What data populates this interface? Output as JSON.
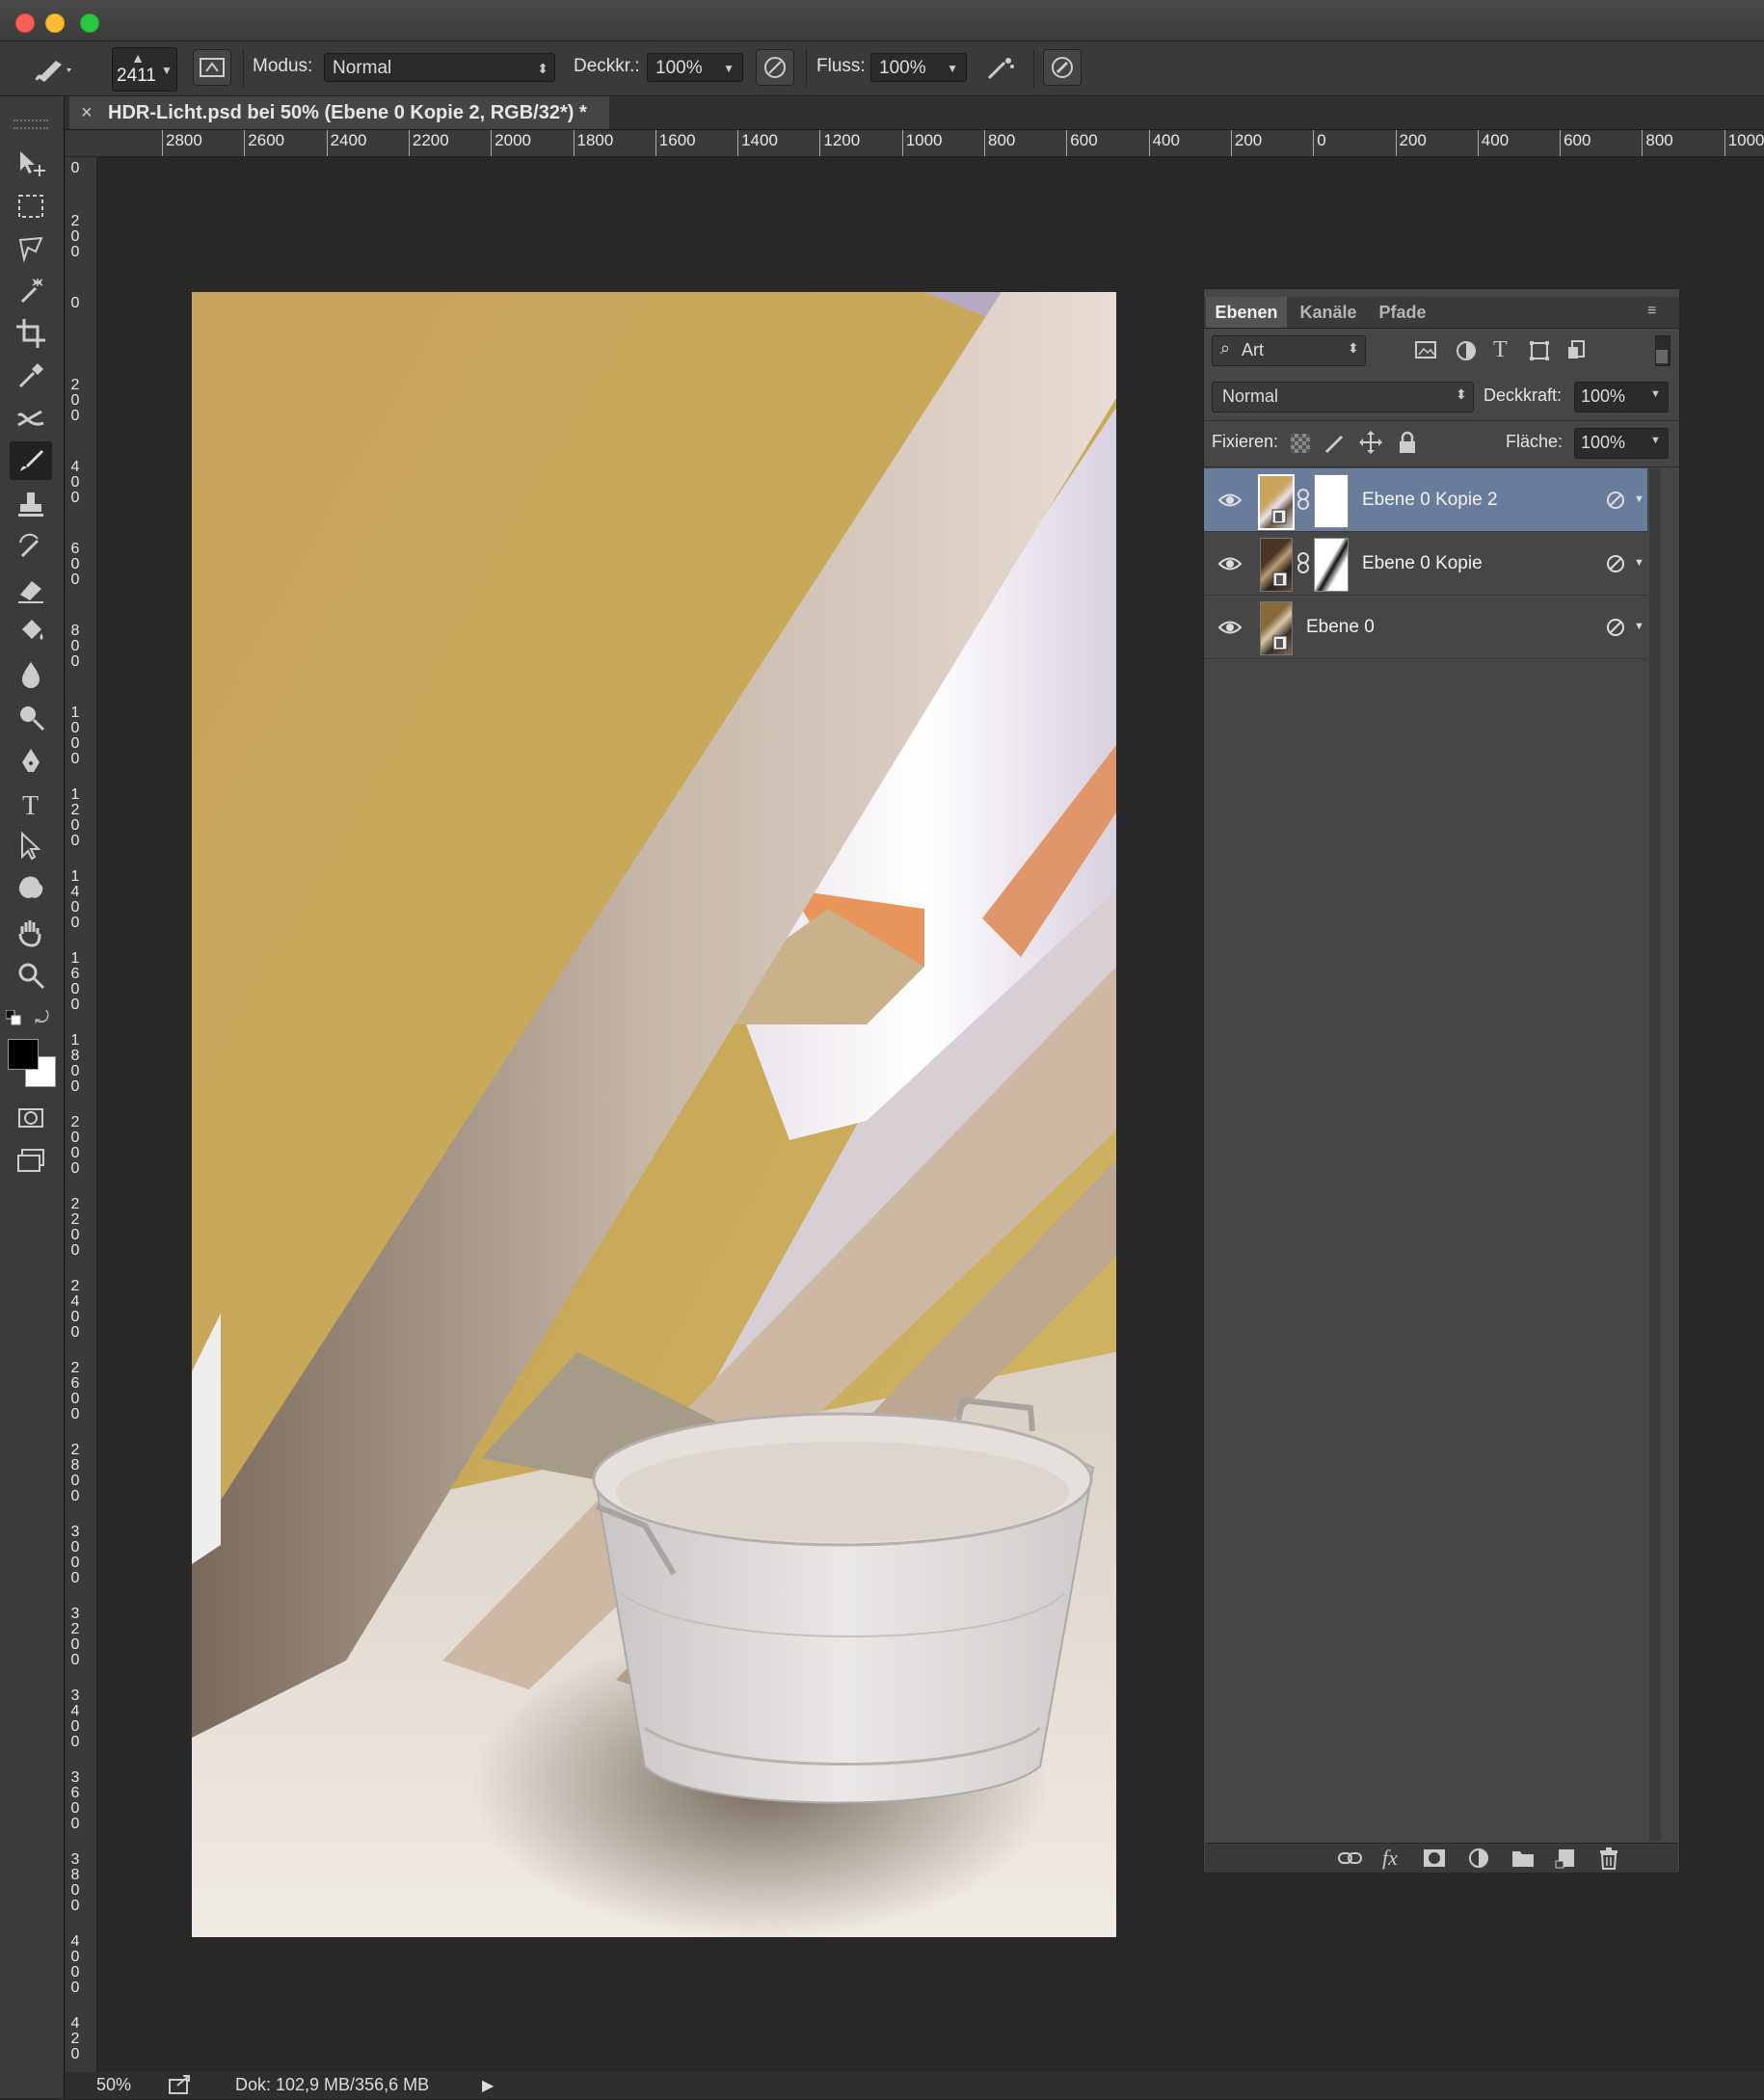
{
  "options": {
    "brush_size": "2411",
    "mode_label": "Modus:",
    "mode_value": "Normal",
    "opacity_label": "Deckkr.:",
    "opacity_value": "100%",
    "flow_label": "Fluss:",
    "flow_value": "100%"
  },
  "document": {
    "tab_close": "×",
    "tab_title": "HDR-Licht.psd bei 50% (Ebene 0 Kopie 2, RGB/32*) *"
  },
  "ruler": {
    "h_labels": [
      "2800",
      "2600",
      "2400",
      "2200",
      "2000",
      "1800",
      "1600",
      "1400",
      "1200",
      "1000",
      "800",
      "600",
      "400",
      "200",
      "0",
      "200",
      "400",
      "600",
      "800",
      "1000"
    ],
    "v_labels": [
      "0",
      "200",
      "0",
      "200",
      "400",
      "600",
      "800",
      "1000",
      "1200",
      "1400",
      "1600",
      "1800",
      "2000",
      "2200",
      "2400",
      "2600",
      "2800",
      "3000",
      "3200",
      "3400",
      "3600",
      "3800",
      "4000",
      "420"
    ]
  },
  "layers_panel": {
    "tabs": [
      "Ebenen",
      "Kanäle",
      "Pfade"
    ],
    "filter_value": "Art",
    "blend_mode": "Normal",
    "opacity_label": "Deckkraft:",
    "opacity_value": "100%",
    "lock_label": "Fixieren:",
    "fill_label": "Fläche:",
    "fill_value": "100%",
    "layers": [
      {
        "name": "Ebene 0 Kopie 2",
        "selected": true,
        "has_mask": true
      },
      {
        "name": "Ebene 0 Kopie",
        "selected": false,
        "has_mask": true
      },
      {
        "name": "Ebene 0",
        "selected": false,
        "has_mask": false
      }
    ],
    "footer_icons": [
      "link-icon",
      "fx-icon",
      "mask-icon",
      "adjustment-icon",
      "folder-icon",
      "new-layer-icon",
      "trash-icon"
    ]
  },
  "status": {
    "zoom": "50%",
    "doc_info": "Dok: 102,9 MB/356,6 MB"
  },
  "colors": {
    "selection": "#6a7c9c",
    "panel_bg": "#464646",
    "workspace": "#282828"
  }
}
